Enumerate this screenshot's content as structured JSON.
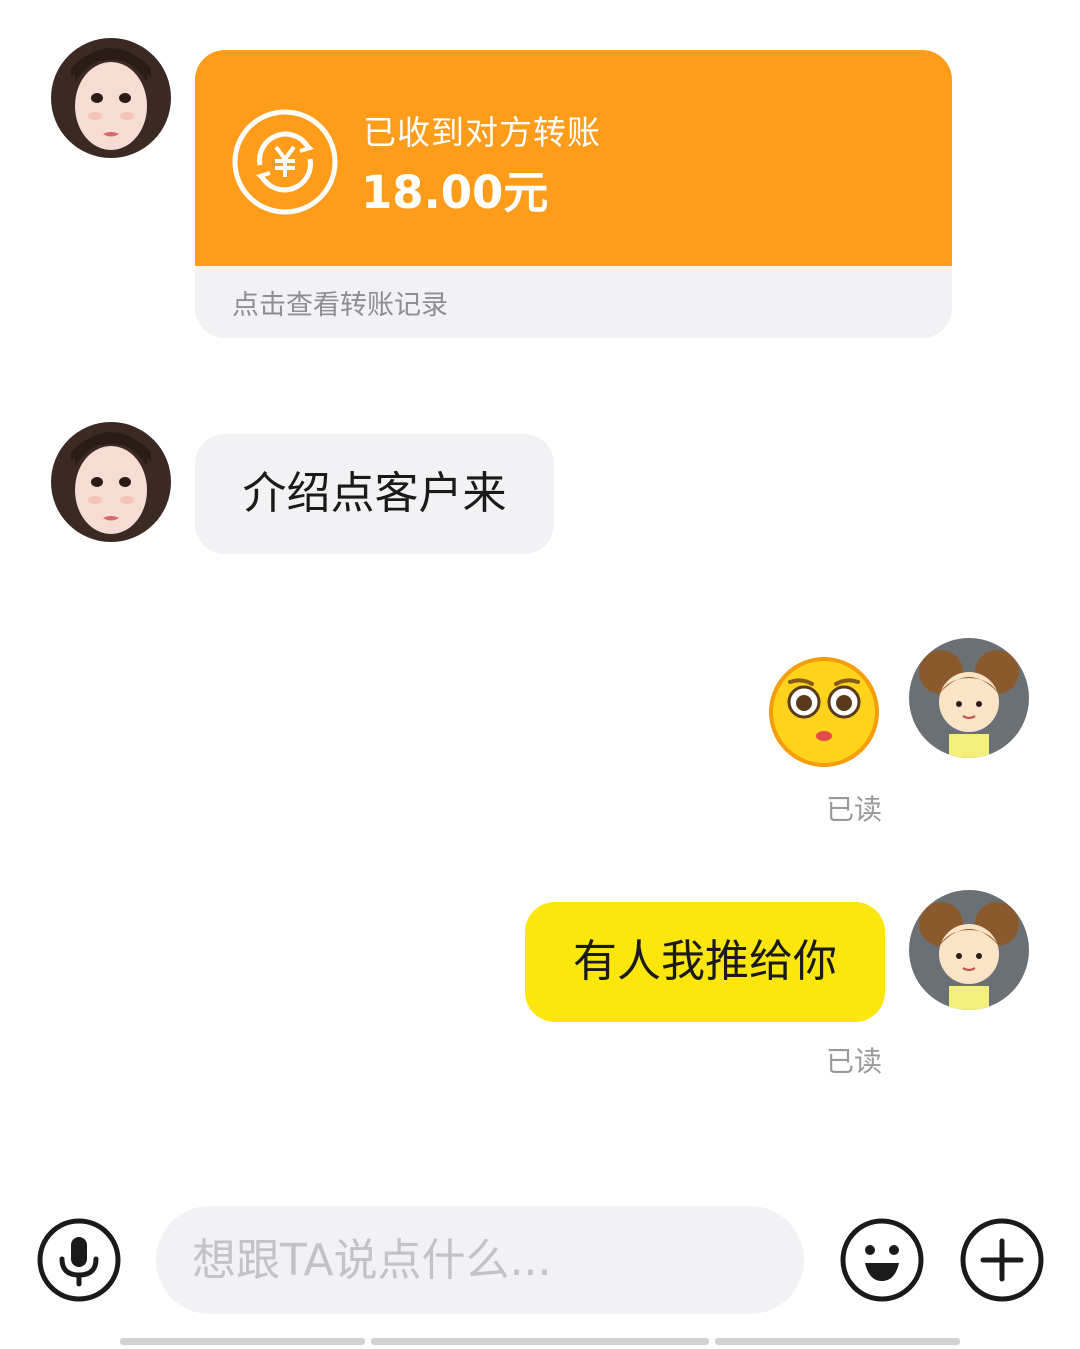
{
  "transfer": {
    "title": "已收到对方转账",
    "amount": "18.00元",
    "footer": "点击查看转账记录",
    "icon": "yuan-exchange-icon",
    "color": "#ff9d1b"
  },
  "messages": {
    "incoming_text": "介绍点客户来",
    "outgoing_emoji": "pleading-face-emoji",
    "outgoing_text": "有人我推给你",
    "read_status": "已读"
  },
  "input_bar": {
    "placeholder": "想跟TA说点什么...",
    "voice_icon": "microphone-icon",
    "emoji_icon": "smiley-icon",
    "plus_icon": "plus-icon"
  },
  "colors": {
    "outgoing_bubble": "#fde60c",
    "incoming_bubble": "#f2f2f4",
    "muted_text": "#9a9a9a"
  }
}
